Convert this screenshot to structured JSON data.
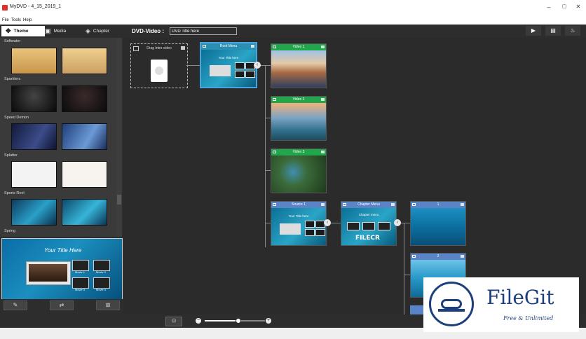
{
  "window": {
    "title": "MyDVD - 4_15_2019_1",
    "minimize": "–",
    "maximize": "▢",
    "close": "✕"
  },
  "menu": {
    "items": [
      "File",
      "Tools",
      "Help"
    ]
  },
  "left_panel": {
    "tabs": [
      {
        "label": "Theme"
      },
      {
        "label": "Media"
      },
      {
        "label": "Chapter"
      }
    ],
    "categories": [
      "Softwater",
      "Sparklers",
      "Speed Demon",
      "Splatter",
      "Sports Reel",
      "Spring"
    ],
    "preview_title": "Your Title Here",
    "preview_buttons": [
      "Movie 1",
      "Movie 2",
      "Movie 3",
      "Movie 4"
    ]
  },
  "toolbar": {
    "dvd_label": "DVD-Video :",
    "title_value": "DVD Title here",
    "play": "▶",
    "save": "💾",
    "burn": "🔥"
  },
  "canvas": {
    "intro": {
      "label": "Drag Intro video"
    },
    "root_menu": {
      "label": "Root Menu",
      "subtitle": "Your Title here"
    },
    "videos": [
      {
        "label": "Video 1"
      },
      {
        "label": "Video 2"
      },
      {
        "label": "Video 3"
      }
    ],
    "source": {
      "label": "Source 1",
      "subtitle": "Your Title here"
    },
    "chapter_menu": {
      "label": "Chapter Menu",
      "subtitle": "Chapter menu",
      "watermark": "FILECR"
    },
    "chapters": [
      {
        "label": "1"
      },
      {
        "label": "2"
      }
    ]
  },
  "zoom": {
    "minus": "−",
    "plus": "+",
    "level": 0.55
  },
  "watermark": {
    "brand": "FileGit",
    "tag": "Free & Unlimited"
  },
  "colors": {
    "green_header": "#22a64b",
    "blue_header": "#5b84c7",
    "selection": "#4aa3df"
  }
}
